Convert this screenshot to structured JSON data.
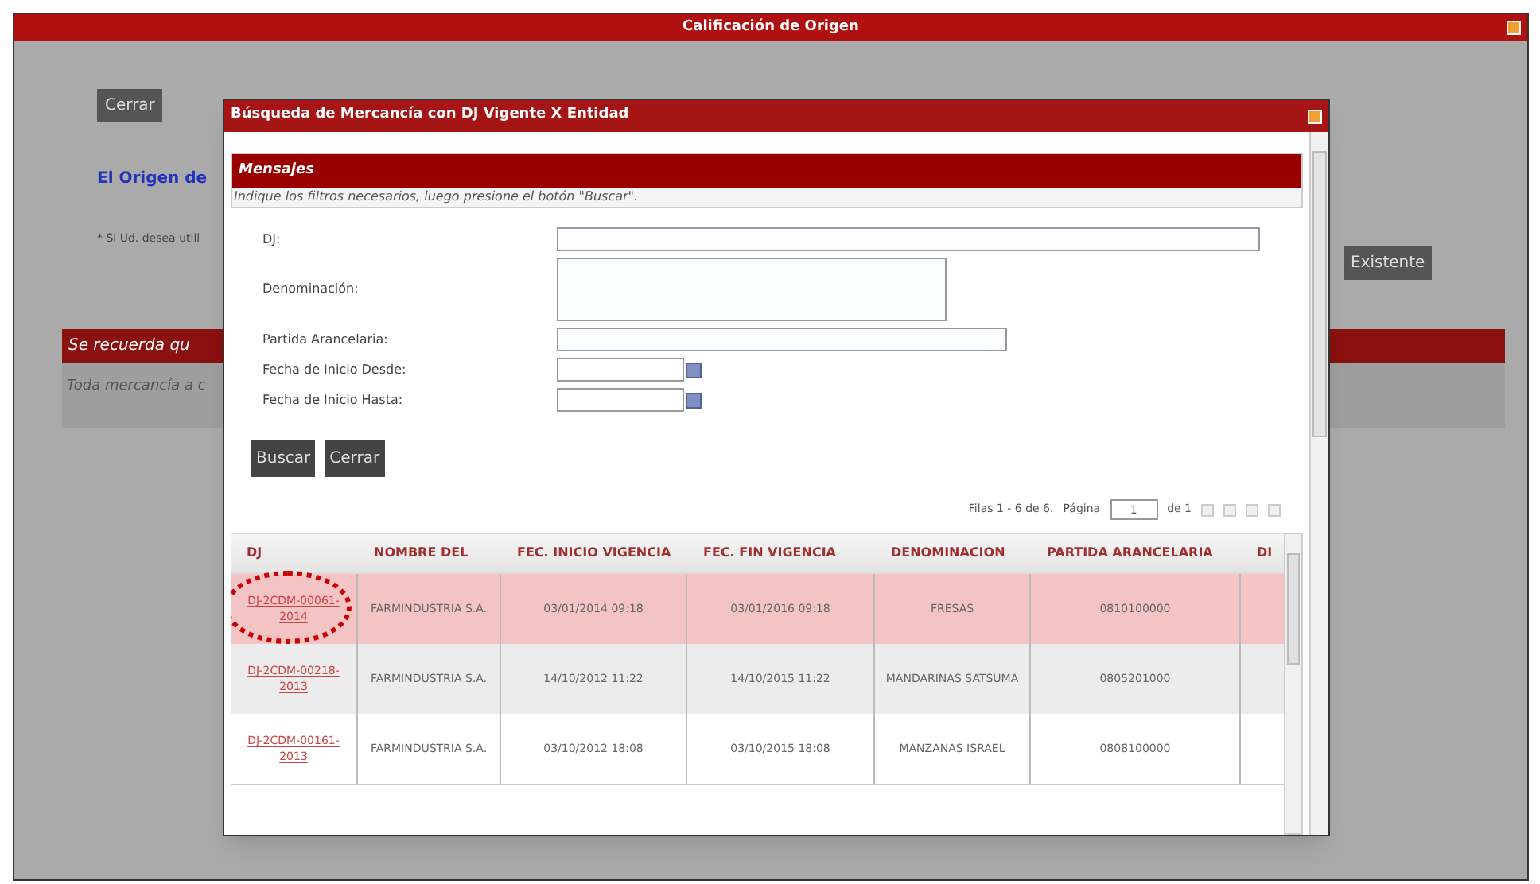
{
  "window": {
    "title": "Calificación de Origen"
  },
  "background": {
    "close_button": "Cerrar",
    "heading": "El Origen de",
    "note": "* Si Ud. desea utili",
    "existing_button": "Existente",
    "notice_title": "Se recuerda qu",
    "notice_text": "Toda mercancía a c"
  },
  "dialog": {
    "title": "Búsqueda de Mercancía con DJ Vigente X Entidad",
    "messages": {
      "title": "Mensajes",
      "text": "Indique los filtros necesarios, luego presione el botón \"Buscar\"."
    },
    "fields": [
      {
        "kind": "text",
        "label": "DJ:"
      },
      {
        "kind": "textarea",
        "label": "Denominación:"
      },
      {
        "kind": "text",
        "label": "Partida Arancelaria:"
      },
      {
        "kind": "date",
        "label": "Fecha de Inicio Desde:"
      },
      {
        "kind": "date",
        "label": "Fecha de Inicio Hasta:"
      }
    ],
    "buttons": [
      "Buscar",
      "Cerrar"
    ],
    "pager": {
      "rows_text": "Filas 1 - 6 de 6.",
      "page_label": "Página",
      "page": "1",
      "of_text": "de 1"
    },
    "table": {
      "columns": [
        "DJ",
        "NOMBRE DEL",
        "FEC. INICIO VIGENCIA",
        "FEC. FIN VIGENCIA",
        "DENOMINACION",
        "PARTIDA ARANCELARIA",
        "DI"
      ],
      "rows": [
        {
          "selected": true,
          "cells": [
            "DJ-2CDM-00061-2014",
            "FARMINDUSTRIA S.A.",
            "03/01/2014 09:18",
            "03/01/2016 09:18",
            "FRESAS",
            "0810100000"
          ]
        },
        {
          "selected": false,
          "cells": [
            "DJ-2CDM-00218-2013",
            "FARMINDUSTRIA S.A.",
            "14/10/2012 11:22",
            "14/10/2015 11:22",
            "MANDARINAS SATSUMA",
            "0805201000"
          ]
        },
        {
          "selected": false,
          "cells": [
            "DJ-2CDM-00161-2013",
            "FARMINDUSTRIA S.A.",
            "03/10/2012 18:08",
            "03/10/2015 18:08",
            "MANZANAS ISRAEL",
            "0808100000"
          ]
        }
      ]
    }
  }
}
